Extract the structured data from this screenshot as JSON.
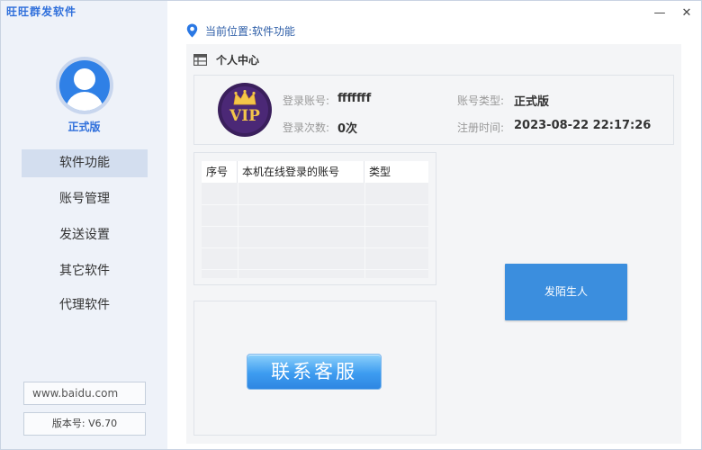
{
  "app": {
    "title": "旺旺群发软件"
  },
  "user": {
    "level": "正式版"
  },
  "nav": [
    {
      "label": "软件功能",
      "active": true
    },
    {
      "label": "账号管理",
      "active": false
    },
    {
      "label": "发送设置",
      "active": false
    },
    {
      "label": "其它软件",
      "active": false
    },
    {
      "label": "代理软件",
      "active": false
    }
  ],
  "footer": {
    "site": "www.baidu.com",
    "version": "版本号: V6.70"
  },
  "window": {
    "minimize": "—",
    "close": "✕"
  },
  "breadcrumb": {
    "text": "当前位置:软件功能"
  },
  "section": {
    "title": "个人中心"
  },
  "profile": {
    "badge": "VIP",
    "account_label": "登录账号:",
    "account_value": "fffffff",
    "type_label": "账号类型:",
    "type_value": "正式版",
    "count_label": "登录次数:",
    "count_value": "0次",
    "reg_label": "注册时间:",
    "reg_value": "2023-08-22 22:17:26"
  },
  "table": {
    "columns": [
      "序号",
      "本机在线登录的账号",
      "类型"
    ],
    "rows": []
  },
  "buttons": {
    "customer_service": "联系客服",
    "send_stranger": "发陌生人"
  },
  "colors": {
    "accent": "#2f6fdb",
    "sidebar_bg": "#eef2f9",
    "button": "#3b8ede"
  }
}
